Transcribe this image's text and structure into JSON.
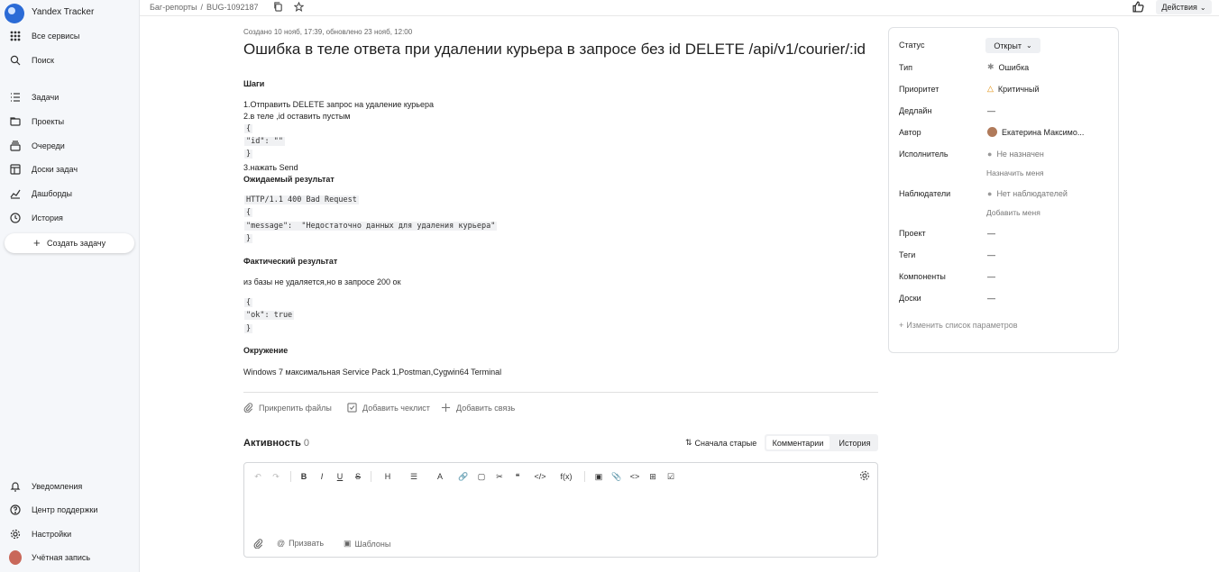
{
  "app": {
    "title": "Yandex Tracker"
  },
  "sidebar": {
    "top_items": [
      {
        "label": "Все сервисы",
        "icon": "grid-icon"
      },
      {
        "label": "Поиск",
        "icon": "search-icon"
      }
    ],
    "nav_items": [
      {
        "label": "Задачи",
        "icon": "tasks-icon"
      },
      {
        "label": "Проекты",
        "icon": "projects-icon"
      },
      {
        "label": "Очереди",
        "icon": "queues-icon"
      },
      {
        "label": "Доски задач",
        "icon": "boards-icon"
      },
      {
        "label": "Дашборды",
        "icon": "dashboards-icon"
      },
      {
        "label": "История",
        "icon": "history-icon"
      }
    ],
    "create_label": "Создать задачу",
    "bottom_items": [
      {
        "label": "Уведомления",
        "icon": "bell-icon"
      },
      {
        "label": "Центр поддержки",
        "icon": "help-icon"
      },
      {
        "label": "Настройки",
        "icon": "gear-icon"
      },
      {
        "label": "Учётная запись",
        "icon": "avatar"
      }
    ]
  },
  "topbar": {
    "breadcrumb_queue": "Баг-репорты",
    "breadcrumb_sep": "/",
    "breadcrumb_issue": "BUG-1092187",
    "actions_label": "Действия"
  },
  "issue": {
    "meta": "Создано 10 нояб, 17:39, обновлено 23 нояб, 12:00",
    "title": "Ошибка в теле ответа при удалении курьера в запросе без id DELETE /api/v1/courier/:id",
    "steps_heading": "Шаги",
    "step1": "1.Отправить DELETE запрос на удаление курьера",
    "step2": "2.в теле ,id оставить пустым",
    "code1_l1": "{",
    "code1_l2": "\"id\": \"\"",
    "code1_l3": "}",
    "step3": "3.нажать Send",
    "expected_heading": "Ожидаемый результат",
    "code2_l1": "HTTP/1.1 400 Bad Request",
    "code2_l2": "{",
    "code2_l3": "\"message\":  \"Недостаточно данных для удаления курьера\"",
    "code2_l4": "}",
    "actual_heading": "Фактический результат",
    "actual_text": "из базы не удаляется,но в запросе 200 ок",
    "code3_l1": "{",
    "code3_l2": "\"ok\": true",
    "code3_l3": "}",
    "env_heading": "Окружение",
    "env_text": "Windows 7 максимальная Service Pack 1,Postman,Cygwin64 Terminal"
  },
  "attachments": {
    "attach_files": "Прикрепить файлы",
    "add_checklist": "Добавить чеклист",
    "add_link": "Добавить связь"
  },
  "activity": {
    "title": "Активность",
    "count": "0",
    "sort_label": "Сначала старые",
    "tab_comments": "Комментарии",
    "tab_history": "История"
  },
  "editor": {
    "toolbar": [
      "↶",
      "↷",
      "B",
      "I",
      "U",
      "S",
      "H",
      "☰",
      "A",
      "🔗",
      "▢",
      "✂",
      "❝",
      "</>",
      "f(x)",
      "▣",
      "📎",
      "<>",
      "⊞",
      "☑"
    ],
    "summon_label": "Призвать",
    "templates_label": "Шаблоны"
  },
  "fields": {
    "status_label": "Статус",
    "status_value": "Открыт",
    "type_label": "Тип",
    "type_value": "Ошибка",
    "priority_label": "Приоритет",
    "priority_value": "Критичный",
    "deadline_label": "Дедлайн",
    "deadline_value": "—",
    "author_label": "Автор",
    "author_value": "Екатерина Максимо...",
    "assignee_label": "Исполнитель",
    "assignee_value": "Не назначен",
    "assign_me": "Назначить меня",
    "followers_label": "Наблюдатели",
    "followers_value": "Нет наблюдателей",
    "add_me": "Добавить меня",
    "project_label": "Проект",
    "project_value": "—",
    "tags_label": "Теги",
    "tags_value": "—",
    "components_label": "Компоненты",
    "components_value": "—",
    "boards_label": "Доски",
    "boards_value": "—",
    "change_params": "Изменить список параметров"
  },
  "colors": {
    "accent": "#2b6bd6",
    "priority": "#e08a00",
    "sidebar_bg": "#f5f7fa"
  }
}
